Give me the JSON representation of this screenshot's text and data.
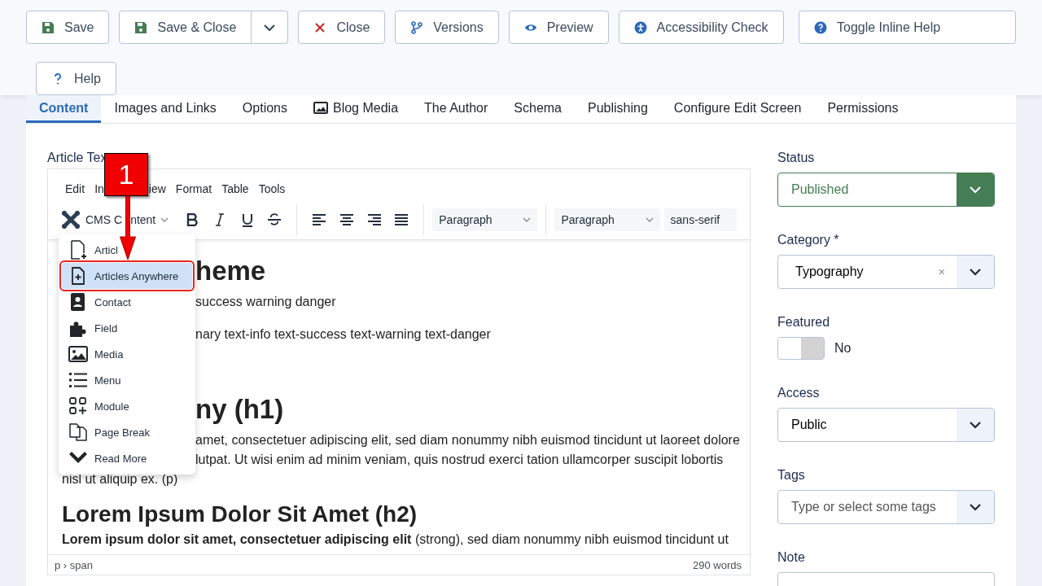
{
  "toolbar": {
    "buttons": [
      {
        "label": "Save",
        "kind": "save"
      },
      {
        "label": "Save & Close",
        "kind": "save-split"
      },
      {
        "label": "Close",
        "kind": "close"
      },
      {
        "label": "Versions",
        "kind": "versions"
      },
      {
        "label": "Preview",
        "kind": "preview"
      },
      {
        "label": "Accessibility Check",
        "kind": "a11y"
      },
      {
        "label": "Toggle Inline Help",
        "kind": "help-toggle"
      },
      {
        "label": "Help",
        "kind": "help"
      }
    ]
  },
  "tabs": [
    {
      "label": "Content",
      "selected": true
    },
    {
      "label": "Images and Links",
      "selected": false
    },
    {
      "label": "Options",
      "selected": false
    },
    {
      "label": "Blog Media",
      "selected": false,
      "kind": "media"
    },
    {
      "label": "The Author",
      "selected": false
    },
    {
      "label": "Schema",
      "selected": false
    },
    {
      "label": "Publishing",
      "selected": false
    },
    {
      "label": "Configure Edit Screen",
      "selected": false
    },
    {
      "label": "Permissions",
      "selected": false
    }
  ],
  "editor": {
    "label": "Article Tex",
    "menubar": [
      "Edit",
      "In",
      "iew",
      "Format",
      "Table",
      "Tools"
    ],
    "cms_content": [
      "CMS C",
      "ntent"
    ],
    "selects": [
      "Paragraph",
      "Paragraph",
      "sans-serif"
    ],
    "cms_menu": [
      {
        "label": "Articl",
        "selected": false
      },
      {
        "label": "Articles Anywhere",
        "selected": true
      },
      {
        "label": "Contact",
        "selected": false
      },
      {
        "label": "Field",
        "selected": false
      },
      {
        "label": "Media",
        "selected": false
      },
      {
        "label": "Menu",
        "selected": false
      },
      {
        "label": "Module",
        "selected": false
      },
      {
        "label": "Page Break",
        "selected": false
      },
      {
        "label": "Read More",
        "selected": false
      }
    ],
    "content": [
      {
        "kind": "h1",
        "text": "heme",
        "covered": true
      },
      {
        "kind": "p",
        "text": "success warning danger",
        "covered": true
      },
      {
        "kind": "p",
        "text": "nary text-info text-success text-warning text-danger",
        "covered": true
      },
      {
        "kind": "gap"
      },
      {
        "kind": "h1",
        "text": "ny (h1)",
        "covered": true
      },
      {
        "kind": "line",
        "text": "amet, consectetuer adipiscing elit, sed diam nonummy nibh euismod tincidunt ut laoreet dolore",
        "covered": true
      },
      {
        "kind": "line",
        "text": "lutpat. Ut wisi enim ad minim veniam, quis nostrud exerci tation ullamcorper suscipit lobortis",
        "covered": true
      },
      {
        "kind": "line",
        "text": "nisl ut aliquip ex. (p)"
      },
      {
        "kind": "h2",
        "text": "Lorem Ipsum Dolor Sit Amet (h2)"
      },
      {
        "kind": "p",
        "text": "**Lorem ipsum dolor sit amet, consectetuer adipiscing elit** (strong), sed diam nonummy nibh euismod tincidunt ut"
      }
    ],
    "path": "p › span",
    "words": "290 words",
    "callout": "1"
  },
  "sidebar": {
    "status": {
      "label": "Status",
      "value": "Published"
    },
    "category": {
      "label": "Category *",
      "value": "Typography",
      "clear": "×"
    },
    "featured": {
      "label": "Featured",
      "on": false,
      "value": "No"
    },
    "access": {
      "label": "Access",
      "value": "Public"
    },
    "tags": {
      "label": "Tags",
      "placeholder": "Type or select some tags"
    },
    "note": {
      "label": "Note"
    }
  }
}
